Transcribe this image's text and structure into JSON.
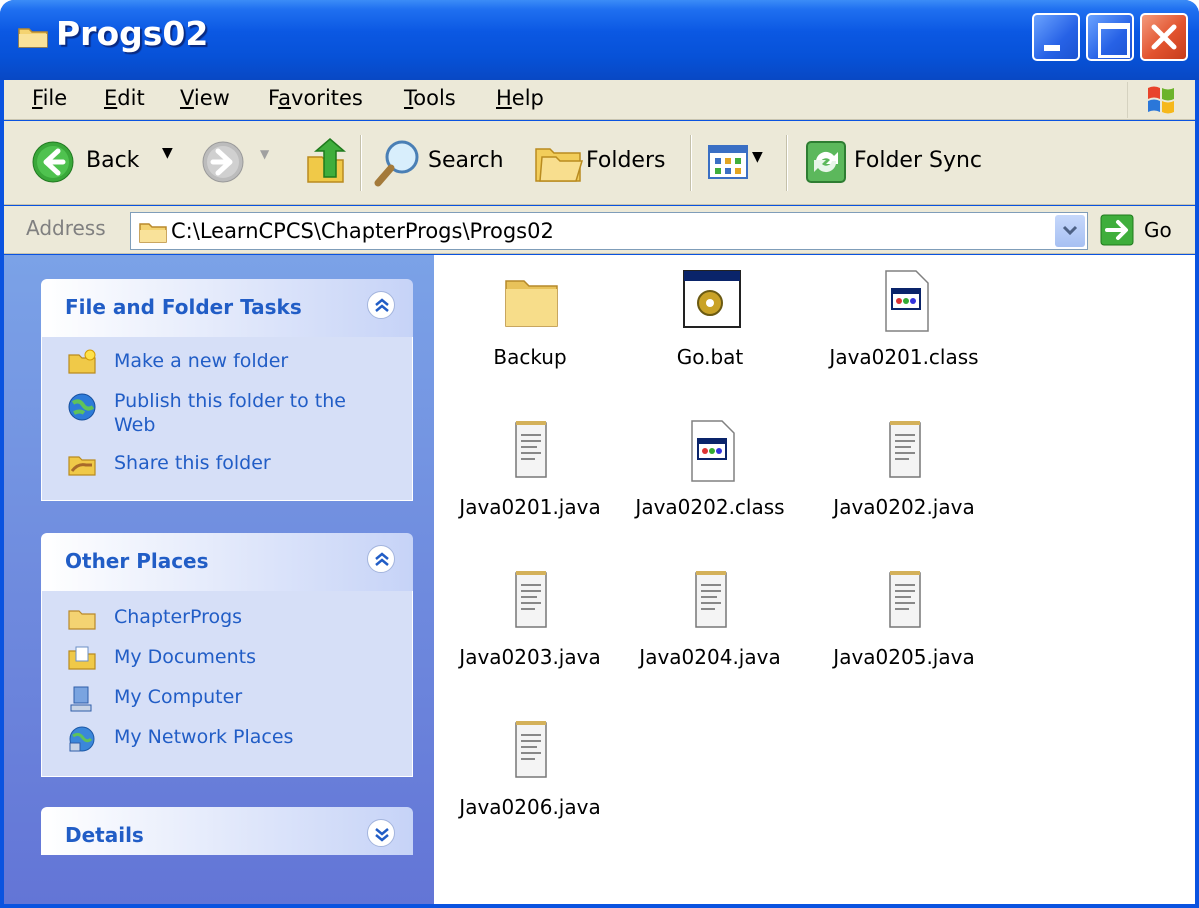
{
  "window": {
    "title": "Progs02"
  },
  "menu": [
    "File",
    "Edit",
    "View",
    "Favorites",
    "Tools",
    "Help"
  ],
  "menu_underline": [
    "F",
    "E",
    "V",
    "a",
    "T",
    "H"
  ],
  "toolbar": {
    "back": "Back",
    "search": "Search",
    "folders": "Folders",
    "folder_sync": "Folder Sync"
  },
  "address": {
    "label": "Address",
    "path": "C:\\LearnCPCS\\ChapterProgs\\Progs02",
    "go": "Go"
  },
  "panels": {
    "file_tasks": {
      "title": "File and Folder Tasks",
      "items": [
        "Make a new folder",
        "Publish this folder to the Web",
        "Share this folder"
      ]
    },
    "other_places": {
      "title": "Other Places",
      "items": [
        "ChapterProgs",
        "My Documents",
        "My Computer",
        "My Network Places"
      ]
    },
    "details": {
      "title": "Details"
    }
  },
  "files": [
    {
      "name": "Backup",
      "icon": "folder-icon"
    },
    {
      "name": "Go.bat",
      "icon": "batch-file-icon"
    },
    {
      "name": "Java0201.class",
      "icon": "class-file-icon"
    },
    {
      "name": "Java0201.java",
      "icon": "text-file-icon"
    },
    {
      "name": "Java0202.class",
      "icon": "class-file-icon"
    },
    {
      "name": "Java0202.java",
      "icon": "text-file-icon"
    },
    {
      "name": "Java0203.java",
      "icon": "text-file-icon"
    },
    {
      "name": "Java0204.java",
      "icon": "text-file-icon"
    },
    {
      "name": "Java0205.java",
      "icon": "text-file-icon"
    },
    {
      "name": "Java0206.java",
      "icon": "text-file-icon"
    }
  ],
  "colors": {
    "titlebar": "#0a53e0",
    "link": "#215dc6",
    "panel_bg": "#d6dff7",
    "pane_bg": "#6f8fdf"
  }
}
